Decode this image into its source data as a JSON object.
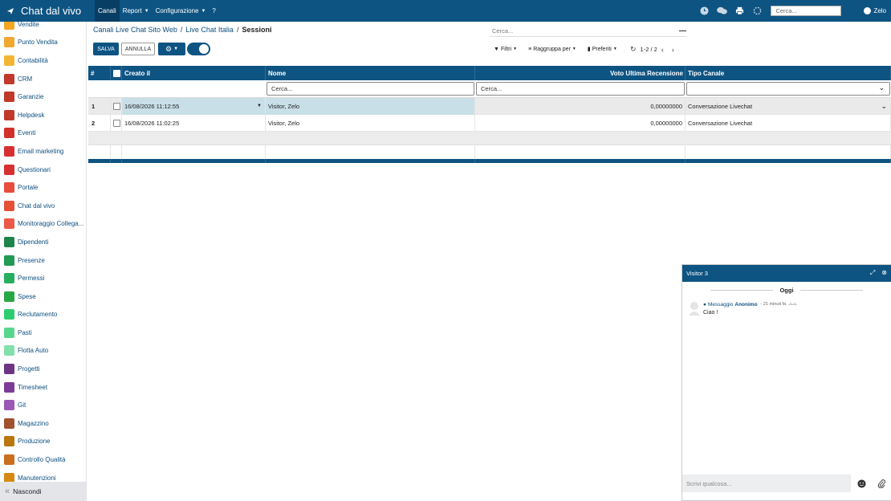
{
  "app": {
    "title": "Chat dal vivo"
  },
  "topnav": [
    {
      "label": "Canali",
      "caret": false,
      "active": true
    },
    {
      "label": "Report",
      "caret": true,
      "active": false
    },
    {
      "label": "Configurazione",
      "caret": true,
      "active": false
    },
    {
      "label": "?",
      "caret": false,
      "active": false
    }
  ],
  "top_right": {
    "search_placeholder": "Cerca...",
    "user": "Zelo"
  },
  "sidebar": {
    "items": [
      {
        "label": "Vendite",
        "icon": "cart-icon",
        "color": "#f5a623"
      },
      {
        "label": "Punto Vendita",
        "icon": "store-icon",
        "color": "#f0a830"
      },
      {
        "label": "Contabilità",
        "icon": "ledger-icon",
        "color": "#f3b634"
      },
      {
        "label": "CRM",
        "icon": "handshake-icon",
        "color": "#c0392b"
      },
      {
        "label": "Garanzie",
        "icon": "shield-icon",
        "color": "#c0392b"
      },
      {
        "label": "Helpdesk",
        "icon": "lifebuoy-icon",
        "color": "#c0392b"
      },
      {
        "label": "Eventi",
        "icon": "ticket-icon",
        "color": "#d0312d"
      },
      {
        "label": "Email marketing",
        "icon": "paper-plane-icon",
        "color": "#d63031"
      },
      {
        "label": "Questionari",
        "icon": "clipboard-icon",
        "color": "#d63031"
      },
      {
        "label": "Portale",
        "icon": "globe-icon",
        "color": "#e74c3c"
      },
      {
        "label": "Chat dal vivo",
        "icon": "chat-bubbles-icon",
        "color": "#e55039"
      },
      {
        "label": "Monitoraggio Collega...",
        "icon": "link-icon",
        "color": "#eb5a46"
      },
      {
        "label": "Dipendenti",
        "icon": "people-icon",
        "color": "#1e8449"
      },
      {
        "label": "Presenze",
        "icon": "person-check-icon",
        "color": "#229954"
      },
      {
        "label": "Permessi",
        "icon": "calendar-leave-icon",
        "color": "#27ae60"
      },
      {
        "label": "Spese",
        "icon": "dollar-icon",
        "color": "#28a745"
      },
      {
        "label": "Reclutamento",
        "icon": "recruit-icon",
        "color": "#2ecc71"
      },
      {
        "label": "Pasti",
        "icon": "fork-knife-icon",
        "color": "#58d68d"
      },
      {
        "label": "Flotta Auto",
        "icon": "car-icon",
        "color": "#82e0aa"
      },
      {
        "label": "Progetti",
        "icon": "puzzle-icon",
        "color": "#6c3483"
      },
      {
        "label": "Timesheet",
        "icon": "clock-icon",
        "color": "#7d3c98"
      },
      {
        "label": "Git",
        "icon": "git-icon",
        "color": "#9b59b6"
      },
      {
        "label": "Magazzino",
        "icon": "box-icon",
        "color": "#a0522d"
      },
      {
        "label": "Produzione",
        "icon": "wrench-icon",
        "color": "#b9770e"
      },
      {
        "label": "Controllo Qualità",
        "icon": "quality-icon",
        "color": "#ca6f1e"
      },
      {
        "label": "Manutenzioni",
        "icon": "hammer-icon",
        "color": "#d68910"
      }
    ],
    "footer_label": "Nascondi"
  },
  "breadcrumb": {
    "items": [
      "Canali Live Chat Sito Web",
      "Live Chat Italia"
    ],
    "current": "Sessioni"
  },
  "control_panel": {
    "search_placeholder": "Cerca...",
    "save_label": "SALVA",
    "cancel_label": "ANNULLA",
    "filters_label": "Filtri",
    "group_label": "Raggruppa per",
    "favorites_label": "Preferiti",
    "pager_value": "1-2 / 2"
  },
  "table": {
    "headers": {
      "num": "#",
      "date": "Creato il",
      "name": "Nome",
      "voto": "Voto Ultima Recensione",
      "tipo": "Tipo Canale"
    },
    "filter_placeholders": {
      "name": "Cerca...",
      "voto": "Cerca..."
    },
    "rows": [
      {
        "num": "1",
        "date": "16/08/2026 11:12:55",
        "name": "Visitor, Zelo",
        "voto": "0,00000000",
        "tipo": "Conversazione Livechat"
      },
      {
        "num": "2",
        "date": "16/08/2026 11:02:25",
        "name": "Visitor, Zelo",
        "voto": "0,00000000",
        "tipo": "Conversazione Livechat"
      }
    ]
  },
  "chat": {
    "title": "Visitor 3",
    "day_label": "Oggi",
    "message": {
      "prefix": "Messaggio",
      "author": "Anonimo",
      "time": "- 21 minuti fa",
      "text": "Ciao !"
    },
    "input_placeholder": "Scrivi qualcosa..."
  },
  "colors": {
    "brand": "#0e5483",
    "brand_dark": "#083e63",
    "row_edit": "#c9dfe8"
  }
}
